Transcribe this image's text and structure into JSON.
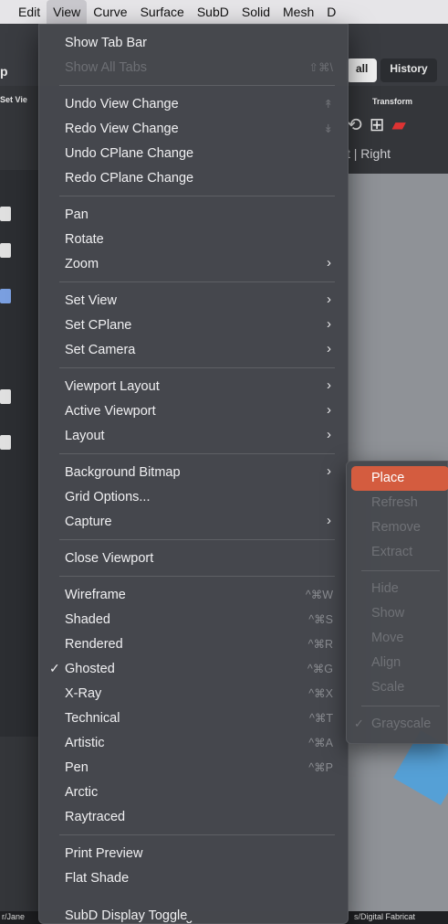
{
  "menubar": {
    "items": [
      "Edit",
      "View",
      "Curve",
      "Surface",
      "SubD",
      "Solid",
      "Mesh",
      "D"
    ],
    "active": "View"
  },
  "background": {
    "left_fragment": "p",
    "set_view_fragment": "Set Vie",
    "tabs": [
      "all",
      "History"
    ],
    "transform_label": "Transform",
    "viewport_tabs": "t  |  Right",
    "viewport_marker": "P",
    "bottom_left": "r/Jane",
    "bottom_right": "s/Digital Fabricat"
  },
  "menu": {
    "groups": [
      [
        {
          "label": "Show Tab Bar"
        },
        {
          "label": "Show All Tabs",
          "shortcut": "⇧⌘\\",
          "disabled": true
        }
      ],
      [
        {
          "label": "Undo View Change",
          "shortcut": "↟",
          "disabled_shortcut": true
        },
        {
          "label": "Redo View Change",
          "shortcut": "↡",
          "disabled_shortcut": true
        },
        {
          "label": "Undo CPlane Change"
        },
        {
          "label": "Redo CPlane Change"
        }
      ],
      [
        {
          "label": "Pan"
        },
        {
          "label": "Rotate"
        },
        {
          "label": "Zoom",
          "submenu": true
        }
      ],
      [
        {
          "label": "Set View",
          "submenu": true
        },
        {
          "label": "Set CPlane",
          "submenu": true
        },
        {
          "label": "Set Camera",
          "submenu": true
        }
      ],
      [
        {
          "label": "Viewport Layout",
          "submenu": true
        },
        {
          "label": "Active Viewport",
          "submenu": true
        },
        {
          "label": "Layout",
          "submenu": true
        }
      ],
      [
        {
          "label": "Background Bitmap",
          "submenu": true
        },
        {
          "label": "Grid Options..."
        },
        {
          "label": "Capture",
          "submenu": true
        }
      ],
      [
        {
          "label": "Close Viewport"
        }
      ],
      [
        {
          "label": "Wireframe",
          "shortcut": "^⌘W"
        },
        {
          "label": "Shaded",
          "shortcut": "^⌘S"
        },
        {
          "label": "Rendered",
          "shortcut": "^⌘R"
        },
        {
          "label": "Ghosted",
          "shortcut": "^⌘G",
          "checked": true
        },
        {
          "label": "X-Ray",
          "shortcut": "^⌘X"
        },
        {
          "label": "Technical",
          "shortcut": "^⌘T"
        },
        {
          "label": "Artistic",
          "shortcut": "^⌘A"
        },
        {
          "label": "Pen",
          "shortcut": "^⌘P"
        },
        {
          "label": "Arctic"
        },
        {
          "label": "Raytraced"
        }
      ],
      [
        {
          "label": "Print Preview"
        },
        {
          "label": "Flat Shade"
        },
        {
          "label": "SubD Display Toggle",
          "cut_off": true
        }
      ]
    ],
    "more_arrow": "⌄",
    "submenu_arrow": "›",
    "check_mark": "✓"
  },
  "submenu": {
    "parent": "Background Bitmap",
    "groups": [
      [
        {
          "label": "Place",
          "highlighted": true
        },
        {
          "label": "Refresh",
          "disabled": true
        },
        {
          "label": "Remove",
          "disabled": true
        },
        {
          "label": "Extract",
          "disabled": true
        }
      ],
      [
        {
          "label": "Hide",
          "disabled": true
        },
        {
          "label": "Show",
          "disabled": true
        },
        {
          "label": "Move",
          "disabled": true
        },
        {
          "label": "Align",
          "disabled": true
        },
        {
          "label": "Scale",
          "disabled": true
        }
      ],
      [
        {
          "label": "Grayscale",
          "disabled": true,
          "checked": true
        }
      ]
    ]
  },
  "colors": {
    "menubar_bg": "#e6e5e8",
    "menu_bg": "#46484d",
    "highlight": "#d45c3f",
    "disabled_text": "#6d6f74"
  }
}
